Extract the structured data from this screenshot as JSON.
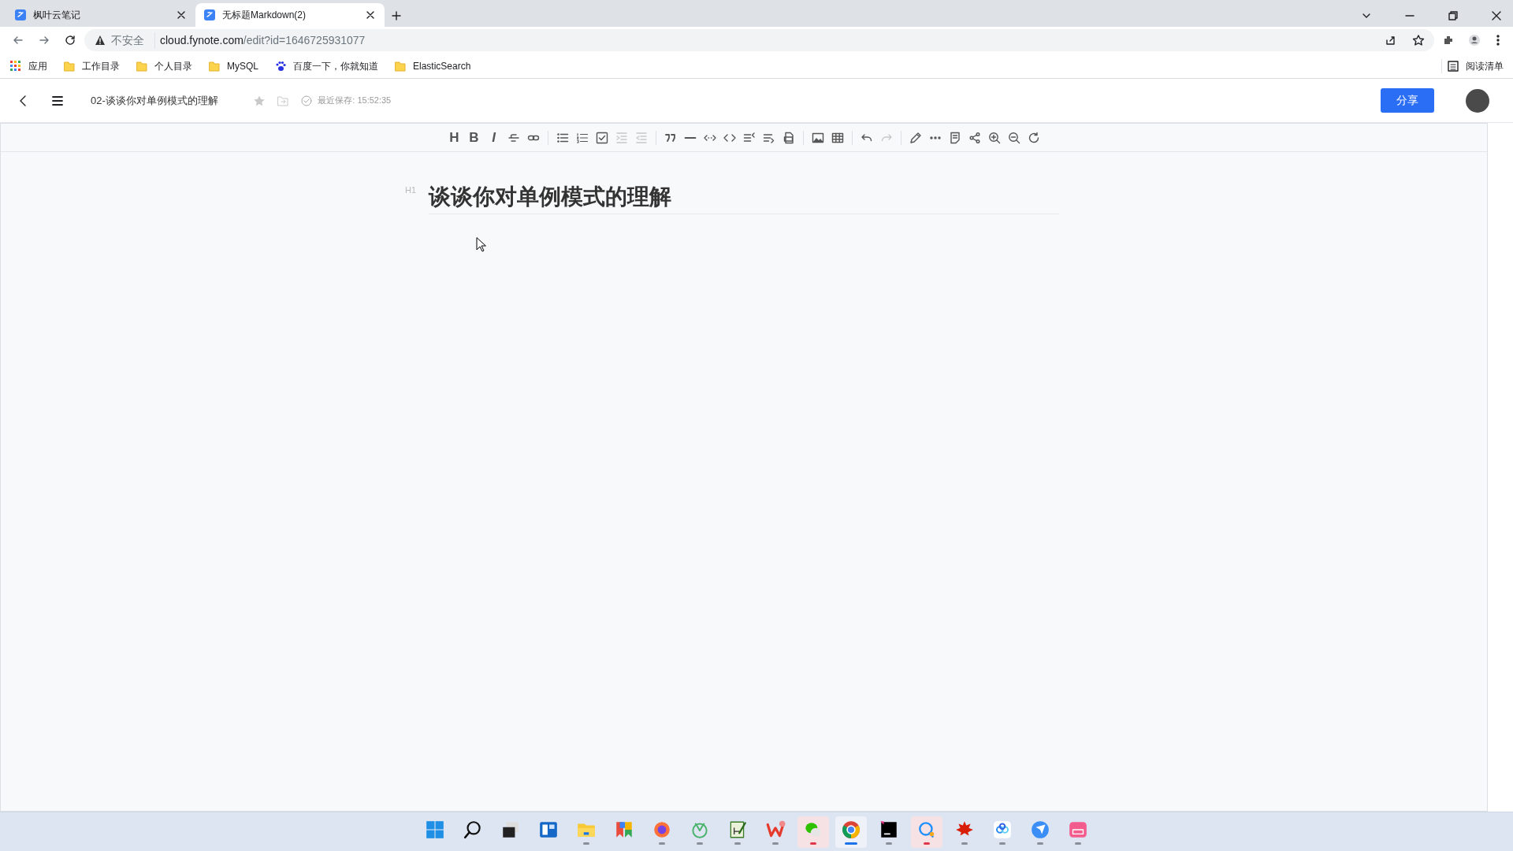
{
  "browser": {
    "tabs": [
      {
        "title": "枫叶云笔记",
        "selected": false
      },
      {
        "title": "无标题Markdown(2)",
        "selected": true
      }
    ],
    "address": {
      "security": "不安全",
      "host": "cloud.fynote.com",
      "path": "/edit?id=1646725931077"
    },
    "bookmarks": [
      {
        "label": "应用",
        "kind": "apps"
      },
      {
        "label": "工作目录",
        "kind": "folder"
      },
      {
        "label": "个人目录",
        "kind": "folder"
      },
      {
        "label": "MySQL",
        "kind": "folder"
      },
      {
        "label": "百度一下，你就知道",
        "kind": "paw"
      },
      {
        "label": "ElasticSearch",
        "kind": "folder"
      }
    ],
    "reading_list": "阅读清单"
  },
  "app": {
    "title": "02-谈谈你对单例模式的理解",
    "starred": false,
    "saved_status": "最近保存: 15:52:35",
    "share": "分享",
    "toolbar": [
      [
        {
          "kind": "heading",
          "label": "H",
          "disabled": false
        },
        {
          "kind": "bold",
          "label": "B",
          "disabled": false
        },
        {
          "kind": "italic",
          "label": "I",
          "disabled": false
        },
        {
          "kind": "strike",
          "disabled": false
        },
        {
          "kind": "link",
          "disabled": false
        }
      ],
      [
        {
          "kind": "ul",
          "disabled": false
        },
        {
          "kind": "ol",
          "disabled": false
        },
        {
          "kind": "task",
          "disabled": false
        },
        {
          "kind": "indent",
          "disabled": true
        },
        {
          "kind": "outdent",
          "disabled": true
        }
      ],
      [
        {
          "kind": "quote",
          "disabled": false
        },
        {
          "kind": "hr",
          "disabled": false
        },
        {
          "kind": "inline-code",
          "disabled": false
        },
        {
          "kind": "code",
          "disabled": false
        },
        {
          "kind": "list-left",
          "disabled": false
        },
        {
          "kind": "list-right",
          "disabled": false
        },
        {
          "kind": "print",
          "disabled": false
        }
      ],
      [
        {
          "kind": "image",
          "disabled": false
        },
        {
          "kind": "table",
          "disabled": false
        }
      ],
      [
        {
          "kind": "undo",
          "disabled": false
        },
        {
          "kind": "redo",
          "disabled": true
        }
      ],
      [
        {
          "kind": "pen",
          "disabled": false
        },
        {
          "kind": "more",
          "disabled": false
        },
        {
          "kind": "note",
          "disabled": false
        },
        {
          "kind": "share",
          "disabled": false
        },
        {
          "kind": "zoom-in",
          "disabled": false
        },
        {
          "kind": "zoom-out",
          "disabled": false
        },
        {
          "kind": "refresh",
          "disabled": false
        }
      ]
    ],
    "document": {
      "heading_marker": "H1",
      "heading": "谈谈你对单例模式的理解"
    }
  },
  "taskbar": [
    {
      "kind": "start",
      "running": false,
      "active": false,
      "attention": false
    },
    {
      "kind": "search",
      "running": false,
      "active": false,
      "attention": false
    },
    {
      "kind": "taskview",
      "running": false,
      "active": false,
      "attention": false
    },
    {
      "kind": "widgets",
      "running": false,
      "active": false,
      "attention": false
    },
    {
      "kind": "explorer",
      "running": true,
      "active": false,
      "attention": false
    },
    {
      "kind": "store",
      "running": false,
      "active": false,
      "attention": false
    },
    {
      "kind": "firefox",
      "running": true,
      "active": false,
      "attention": false
    },
    {
      "kind": "green",
      "running": true,
      "active": false,
      "attention": false
    },
    {
      "kind": "notepad",
      "running": true,
      "active": false,
      "attention": false
    },
    {
      "kind": "wps",
      "running": true,
      "active": false,
      "attention": false
    },
    {
      "kind": "wechat",
      "running": true,
      "active": false,
      "attention": true
    },
    {
      "kind": "chrome",
      "running": true,
      "active": true,
      "attention": false
    },
    {
      "kind": "ide",
      "running": true,
      "active": false,
      "attention": false
    },
    {
      "kind": "chat",
      "running": true,
      "active": false,
      "attention": true
    },
    {
      "kind": "leaf",
      "running": true,
      "active": false,
      "attention": false
    },
    {
      "kind": "cloud",
      "running": true,
      "active": false,
      "attention": false
    },
    {
      "kind": "bird",
      "running": true,
      "active": false,
      "attention": false
    },
    {
      "kind": "video",
      "running": true,
      "active": false,
      "attention": false
    }
  ]
}
